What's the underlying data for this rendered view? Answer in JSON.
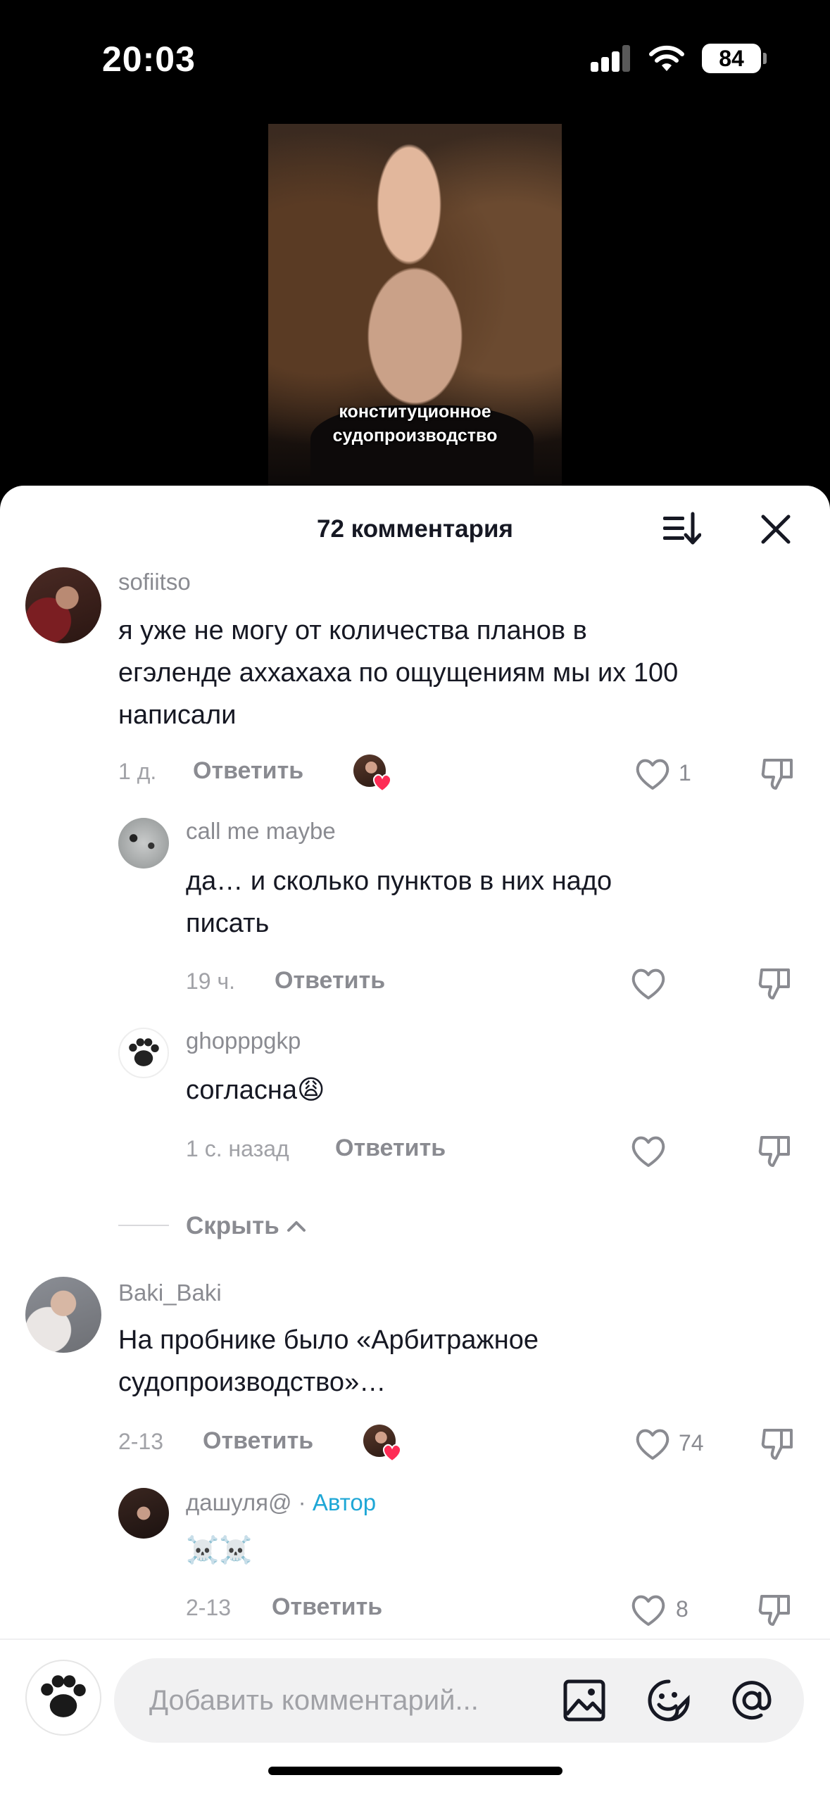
{
  "status": {
    "time": "20:03",
    "battery": "84"
  },
  "video": {
    "caption_line1": "конституционное",
    "caption_line2": "судопроизводство"
  },
  "header": {
    "title": "72 комментария"
  },
  "comments": [
    {
      "user": "sofiitso",
      "line1": "я уже не могу от количества планов в",
      "line2": "егэленде аххахаха по ощущениям мы их 100",
      "line3": "написали",
      "time": "1 д.",
      "reply": "Ответить",
      "likes": "1"
    },
    {
      "user": "call me maybe",
      "line1": "да… и сколько пунктов в них надо",
      "line2": "писать",
      "time": "19 ч.",
      "reply": "Ответить"
    },
    {
      "user": "ghopppgkp",
      "line1": "согласна",
      "emoji": "😩",
      "time": "1 с. назад",
      "reply": "Ответить"
    },
    {
      "user": "Baki_Baki",
      "line1": "На пробнике было «Арбитражное",
      "line2": "судопроизводство»…",
      "time": "2-13",
      "reply": "Ответить",
      "likes": "74"
    },
    {
      "user": "дашуля@",
      "dot": "·",
      "badge": "Автор",
      "emoji": "☠️☠️",
      "time": "2-13",
      "reply": "Ответить",
      "likes": "8"
    }
  ],
  "hide": {
    "label": "Скрыть"
  },
  "input": {
    "placeholder": "Добавить комментарий..."
  },
  "icons": [
    "sort-icon",
    "close-icon",
    "heart-icon",
    "dislike-icon",
    "image-icon",
    "emoji-icon",
    "mention-icon"
  ]
}
